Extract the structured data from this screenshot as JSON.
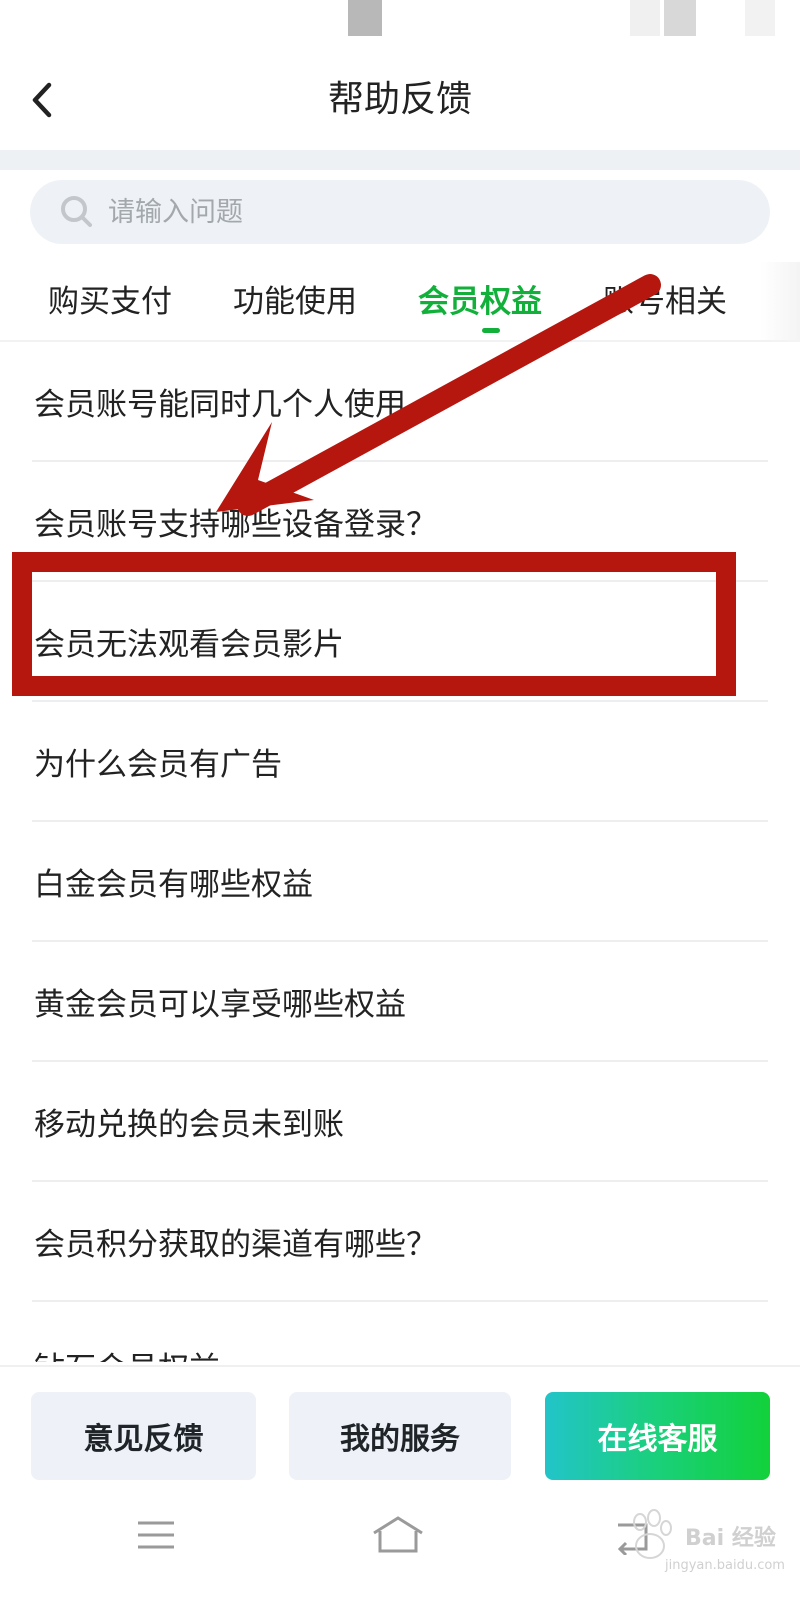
{
  "header": {
    "title": "帮助反馈"
  },
  "search": {
    "placeholder": "请输入问题"
  },
  "tabs": [
    {
      "label": "购买支付",
      "active": false
    },
    {
      "label": "功能使用",
      "active": false
    },
    {
      "label": "会员权益",
      "active": true
    },
    {
      "label": "账号相关",
      "active": false
    }
  ],
  "faq": [
    {
      "question": "会员账号能同时几个人使用"
    },
    {
      "question": "会员账号支持哪些设备登录？"
    },
    {
      "question": "会员无法观看会员影片"
    },
    {
      "question": "为什么会员有广告"
    },
    {
      "question": "白金会员有哪些权益"
    },
    {
      "question": "黄金会员可以享受哪些权益"
    },
    {
      "question": "移动兑换的会员未到账"
    },
    {
      "question": "会员积分获取的渠道有哪些？"
    },
    {
      "question": "钻石会员权益"
    }
  ],
  "bottom_actions": {
    "feedback": "意见反馈",
    "service": "我的服务",
    "online": "在线客服"
  },
  "watermark": {
    "text": "Bai 经验",
    "sub": "jingyan.baidu.com"
  },
  "colors": {
    "accent": "#12b03a",
    "annotation_red": "#b5170f",
    "bg_band": "#eef1f4"
  },
  "icons": {
    "back": "chevron-left-icon",
    "search": "search-icon",
    "nav_menu": "menu-icon",
    "nav_home": "home-icon",
    "nav_back": "back-icon"
  }
}
